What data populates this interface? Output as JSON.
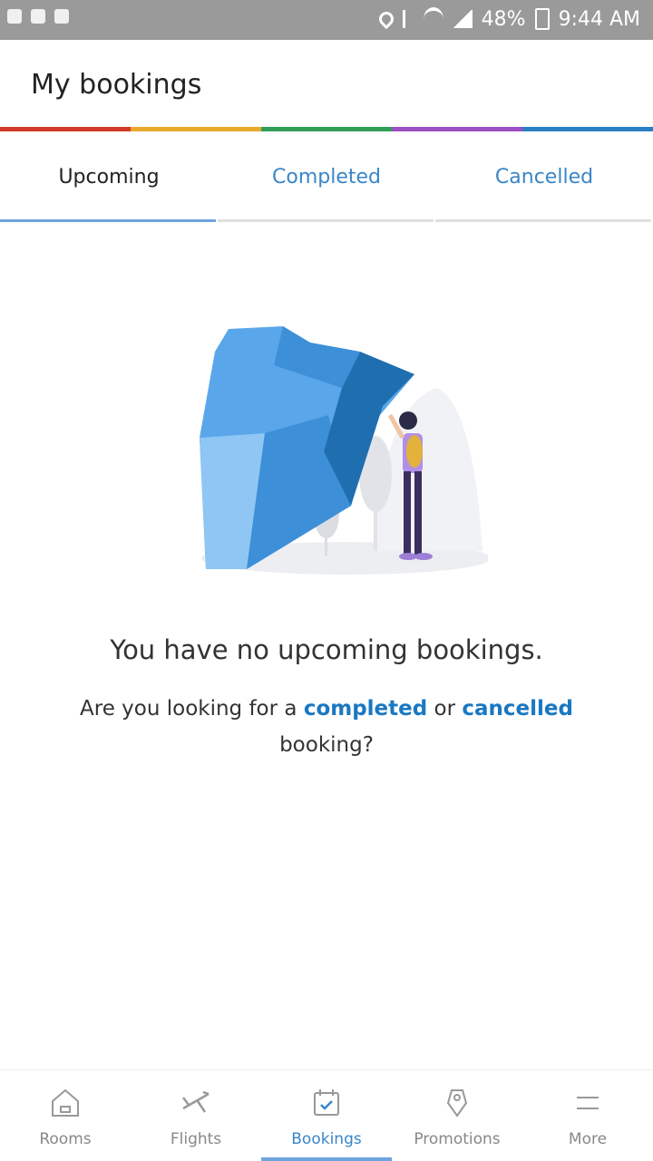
{
  "status_bar": {
    "battery": "48%",
    "time": "9:44 AM"
  },
  "header": {
    "title": "My bookings"
  },
  "stripe_colors": [
    "#d33a2c",
    "#e8a92c",
    "#2f9e57",
    "#9d4fc4",
    "#2a7fc4"
  ],
  "tabs": [
    {
      "label": "Upcoming",
      "active": true
    },
    {
      "label": "Completed",
      "active": false
    },
    {
      "label": "Cancelled",
      "active": false
    }
  ],
  "empty_state": {
    "title": "You have no upcoming bookings.",
    "sub_prefix": "Are you looking for a",
    "link_completed": "completed",
    "sub_or": "or",
    "link_cancelled": "cancelled",
    "sub_suffix": "booking?"
  },
  "bottom_nav": [
    {
      "label": "Rooms",
      "icon": "hotel-icon"
    },
    {
      "label": "Flights",
      "icon": "plane-icon"
    },
    {
      "label": "Bookings",
      "icon": "calendar-check-icon",
      "active": true
    },
    {
      "label": "Promotions",
      "icon": "tag-icon"
    },
    {
      "label": "More",
      "icon": "menu-icon"
    }
  ],
  "colors": {
    "accent": "#3a86c8",
    "link": "#1a78c2"
  }
}
